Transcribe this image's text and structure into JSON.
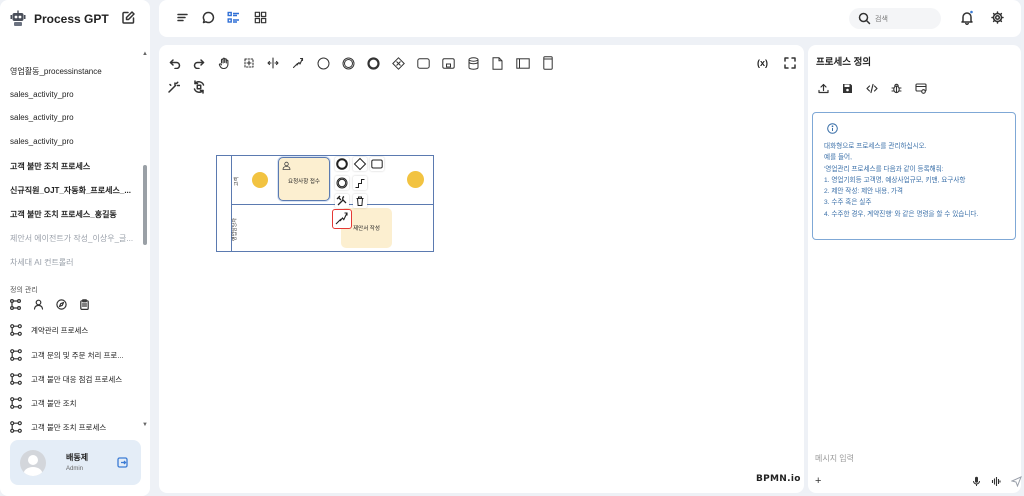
{
  "app": {
    "title": "Process GPT"
  },
  "sidebar": {
    "instances": [
      {
        "label": "영업활동_processinstance",
        "style": "normal"
      },
      {
        "label": "sales_activity_pro",
        "style": "normal"
      },
      {
        "label": "sales_activity_pro",
        "style": "normal"
      },
      {
        "label": "sales_activity_pro",
        "style": "normal"
      },
      {
        "label": "고객 불만 조치 프로세스",
        "style": "bold"
      },
      {
        "label": "신규직원_OJT_자동화_프로세스_...",
        "style": "bold"
      },
      {
        "label": "고객 불만 조치 프로세스_홍길동",
        "style": "bold"
      },
      {
        "label": "제안서 에이전트가 작성_이상우_글...",
        "style": "muted"
      },
      {
        "label": "차세대 AI 컨트롤러",
        "style": "muted"
      }
    ],
    "definitions_title": "정의 관리",
    "definition_icons": [
      "process-flow-icon",
      "person-icon",
      "compass-icon",
      "clipboard-icon"
    ],
    "processes": [
      {
        "label": "계약관리 프로세스"
      },
      {
        "label": "고객 문의 및 주문 처리 프로..."
      },
      {
        "label": "고객 불만 대응 점검 프로세스"
      },
      {
        "label": "고객 불만 조치"
      },
      {
        "label": "고객 불만 조치 프로세스"
      }
    ],
    "user": {
      "name": "배동제",
      "role": "Admin"
    }
  },
  "topbar": {
    "search_placeholder": "검색",
    "nav_icons": [
      "menu-icon",
      "chat-bubble-icon",
      "list-icon",
      "grid-icon"
    ]
  },
  "editor": {
    "variables_label": "(x)",
    "watermark": "BPMN.io",
    "pool": {
      "lanes": [
        {
          "label": "고객"
        },
        {
          "label": "영업담당자"
        }
      ]
    },
    "tasks": [
      {
        "label": "요청사항 접수"
      },
      {
        "label": "제안서 작성"
      }
    ]
  },
  "right_panel": {
    "title": "프로세스 정의",
    "info_lines": [
      "대화형으로 프로세스를 관리하십시오.",
      "예를 들어,",
      "'영업관리 프로세스를 다음과 같이 등록해줘:",
      "1. 영업기회등 고객명, 예상사업규모, 키맨, 요구사항",
      "2. 제안 작성: 제안 내용, 가격",
      "3. 수주 혹은 실주",
      "4. 수주한 경우, 계약진행' 와 같은 명령을 할 수 있습니다."
    ],
    "message_placeholder": "메시지 입력"
  },
  "colors": {
    "accent": "#5b7ab0",
    "event": "#f2c341",
    "task_fill": "#fcefd0",
    "info_text": "#3a6fa8",
    "selection": "#e53935"
  }
}
